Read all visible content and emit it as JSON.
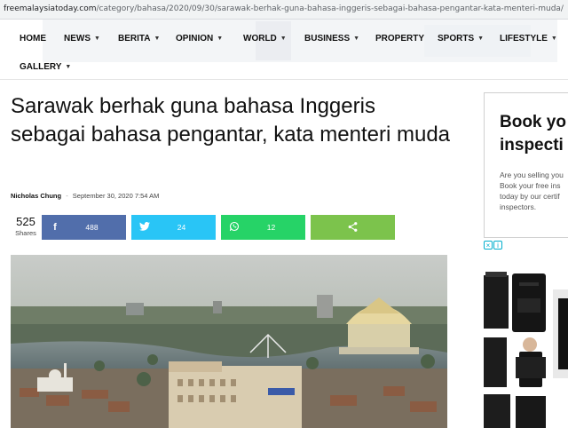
{
  "browser": {
    "url_domain": "freemalaysiatoday.com",
    "url_path": "/category/bahasa/2020/09/30/sarawak-berhak-guna-bahasa-inggeris-sebagai-bahasa-pengantar-kata-menteri-muda/"
  },
  "nav": {
    "items": [
      {
        "label": "HOME",
        "has_dropdown": false
      },
      {
        "label": "NEWS",
        "has_dropdown": true
      },
      {
        "label": "BERITA",
        "has_dropdown": true
      },
      {
        "label": "OPINION",
        "has_dropdown": true
      },
      {
        "label": "WORLD",
        "has_dropdown": true
      },
      {
        "label": "BUSINESS",
        "has_dropdown": true
      },
      {
        "label": "PROPERTY",
        "has_dropdown": false
      },
      {
        "label": "SPORTS",
        "has_dropdown": true
      },
      {
        "label": "LIFESTYLE",
        "has_dropdown": true
      },
      {
        "label": "GALLERY",
        "has_dropdown": true
      }
    ],
    "chevron_icon": "chevron-down-icon"
  },
  "article": {
    "title": "Sarawak berhak guna bahasa Inggeris sebagai bahasa pengantar, kata menteri muda",
    "author": "Nicholas Chung",
    "separator": "-",
    "date": "September 30, 2020 7:54 AM"
  },
  "share": {
    "total_count": "525",
    "total_label": "Shares",
    "facebook_count": "488",
    "twitter_count": "24",
    "whatsapp_count": "12",
    "colors": {
      "facebook": "#516eab",
      "twitter": "#29c5f6",
      "whatsapp": "#26d367",
      "share": "#7cc34c"
    }
  },
  "sidebar_ad": {
    "headline_line1": "Book yo",
    "headline_line2": "inspecti",
    "body_line1": "Are you selling you",
    "body_line2": "Book your free ins",
    "body_line3": "today by our certif",
    "body_line4": "inspectors."
  }
}
